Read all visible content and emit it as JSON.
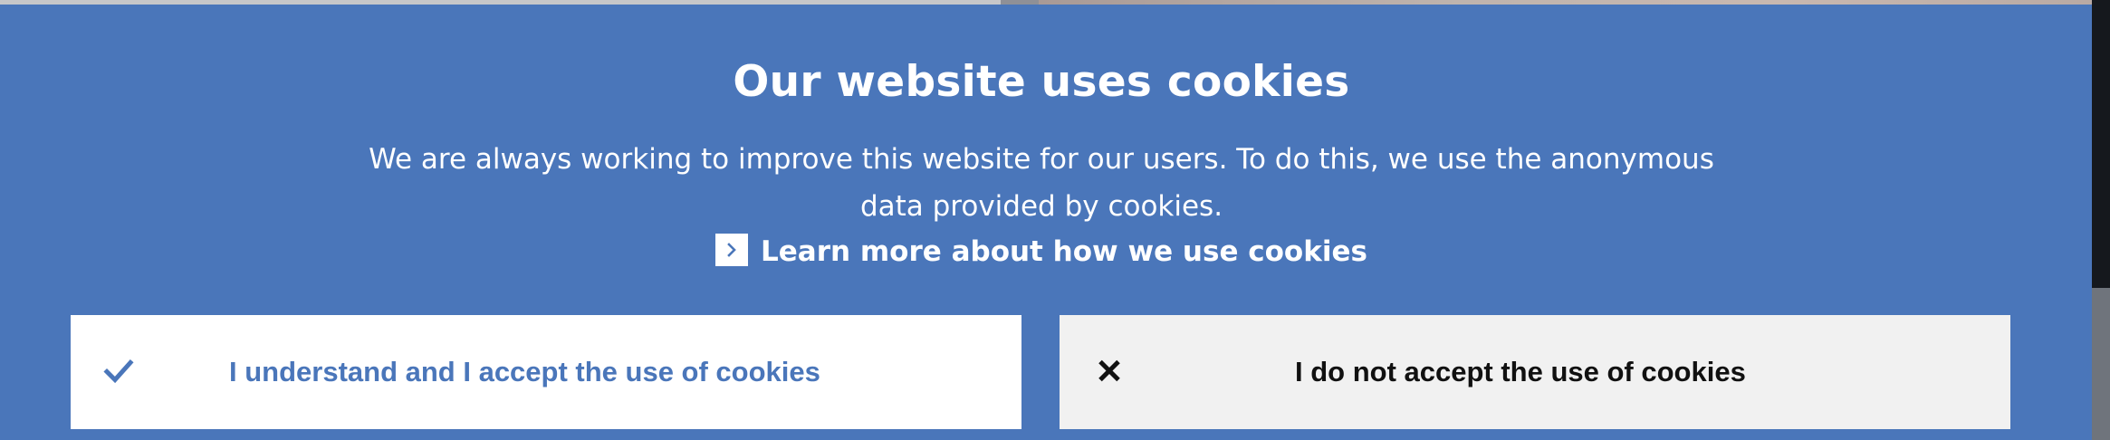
{
  "cookie_banner": {
    "title": "Our website uses cookies",
    "body": "We are always working to improve this website for our users. To do this, we use the anonymous data provided by cookies.",
    "learn_more_label": "Learn more about how we use cookies",
    "accept_label": "I understand and I accept the use of cookies",
    "reject_label": "I do not accept the use of cookies"
  },
  "icons": {
    "learn_more": "chevron-right-icon",
    "accept": "checkmark-icon",
    "reject": "close-icon"
  },
  "colors": {
    "banner_background": "#4a76ba",
    "accent": "#4a76ba",
    "accept_background": "#ffffff",
    "reject_background": "#f1f1f1",
    "reject_text": "#111111"
  }
}
